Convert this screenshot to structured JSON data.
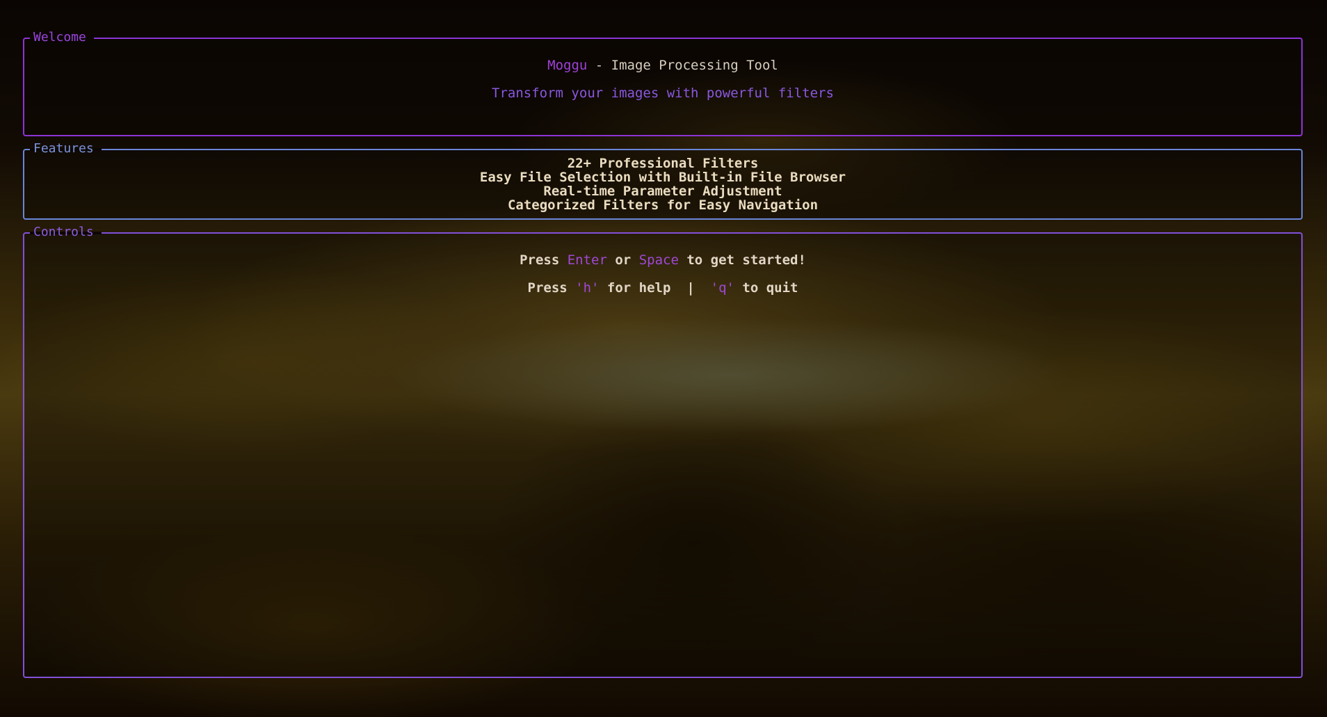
{
  "welcome": {
    "title": "Welcome",
    "app_name": "Moggu",
    "tagline_sep": " - ",
    "tagline": "Image Processing Tool",
    "subtitle": "Transform your images with powerful filters"
  },
  "features": {
    "title": "Features",
    "items": [
      "22+ Professional Filters",
      "Easy File Selection with Built-in File Browser",
      "Real-time Parameter Adjustment",
      "Categorized Filters for Easy Navigation"
    ]
  },
  "controls": {
    "title": "Controls",
    "start_prefix": "Press ",
    "start_key1": "Enter",
    "start_mid": " or ",
    "start_key2": "Space",
    "start_suffix": " to get started!",
    "help_prefix": "Press ",
    "help_key": "'h'",
    "help_mid": " for help  |  ",
    "quit_key": "'q'",
    "quit_suffix": " to quit"
  },
  "colors": {
    "welcome_border": "#8e34d6",
    "features_border": "#6a86d8",
    "controls_border": "#8250d8",
    "accent": "#a040d8"
  }
}
